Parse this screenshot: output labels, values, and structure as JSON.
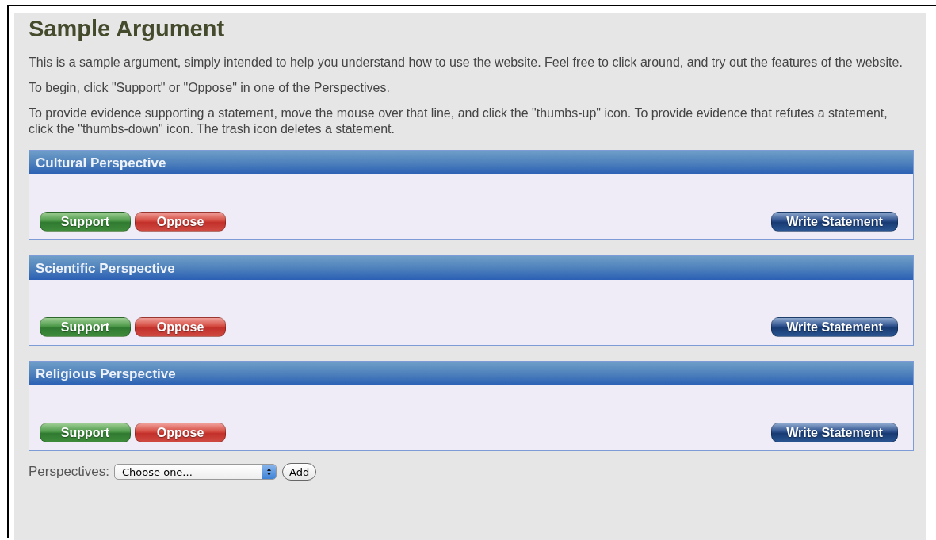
{
  "title": "Sample Argument",
  "paragraphs": [
    "This is a sample argument, simply intended to help you understand how to use the website. Feel free to click around, and try out the features of the website.",
    "To begin, click \"Support\" or \"Oppose\" in one of the Perspectives.",
    "To provide evidence supporting a statement, move the mouse over that line, and click the \"thumbs-up\" icon. To provide evidence that refutes a statement, click the \"thumbs-down\" icon. The trash icon deletes a statement."
  ],
  "perspectives": [
    {
      "title": "Cultural Perspective",
      "buttons": [
        {
          "label": "Support",
          "kind": "support"
        },
        {
          "label": "Oppose",
          "kind": "oppose"
        },
        {
          "label": "Write Statement",
          "kind": "write"
        }
      ]
    },
    {
      "title": "Scientific Perspective",
      "buttons": [
        {
          "label": "Support",
          "kind": "support"
        },
        {
          "label": "Oppose",
          "kind": "oppose"
        },
        {
          "label": "Write Statement",
          "kind": "write"
        }
      ]
    },
    {
      "title": "Religious Perspective",
      "buttons": [
        {
          "label": "Support",
          "kind": "support"
        },
        {
          "label": "Oppose",
          "kind": "oppose"
        },
        {
          "label": "Write Statement",
          "kind": "write"
        }
      ]
    }
  ],
  "footer": {
    "label": "Perspectives:",
    "select_value": "Choose one...",
    "add_button": "Add"
  }
}
